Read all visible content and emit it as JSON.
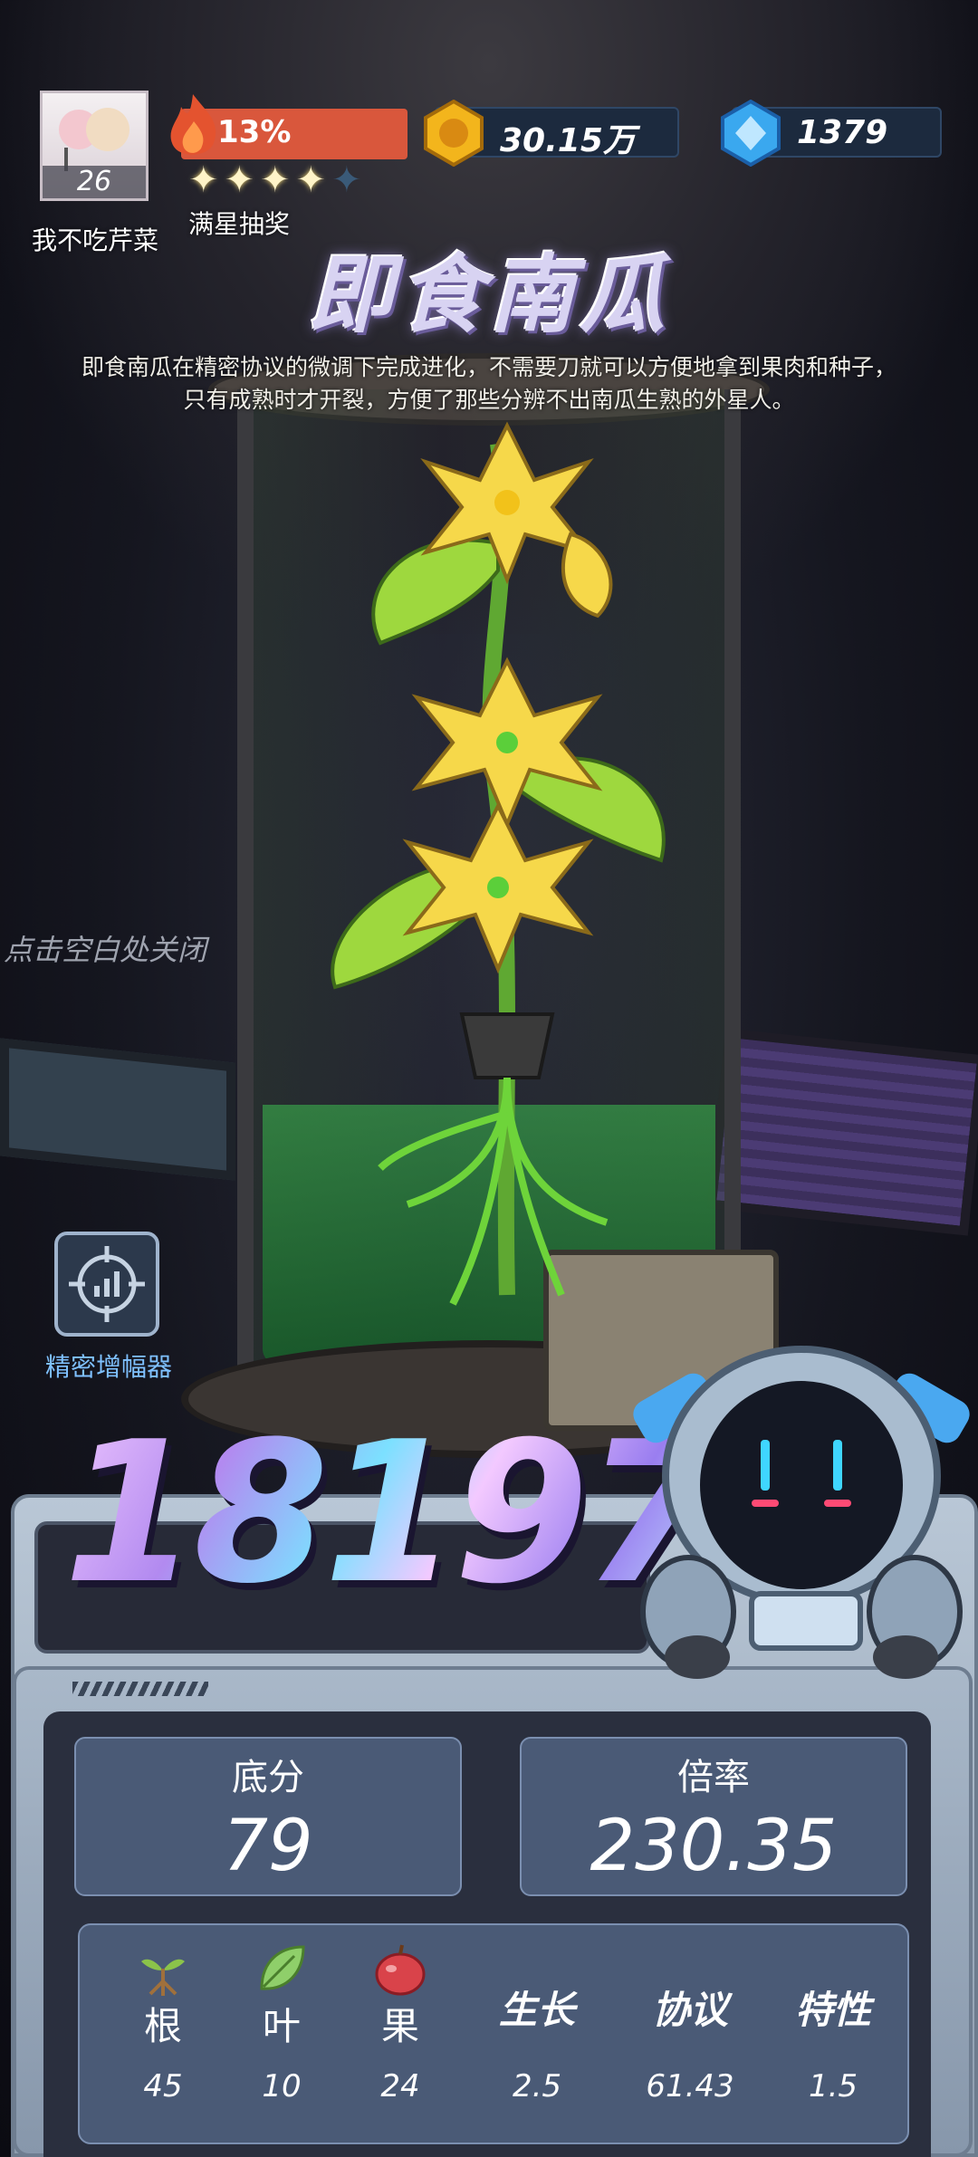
{
  "player": {
    "level": "26",
    "name": "我不吃芹菜"
  },
  "heat": {
    "percent_text": "13%",
    "stars_filled": 4,
    "stars_total": 5,
    "stars_label": "满星抽奖"
  },
  "currency": {
    "coins": "30.15万",
    "gems": "1379"
  },
  "item": {
    "title": "即食南瓜",
    "description": "即食南瓜在精密协议的微调下完成进化，不需要刀就可以方便地拿到果肉和种子，只有成熟时才开裂，方便了那些分辨不出南瓜生熟的外星人。"
  },
  "hints": {
    "close": "点击空白处关闭"
  },
  "amplifier": {
    "label": "精密增幅器",
    "icon": "target-chart-icon"
  },
  "score": {
    "total": "18197"
  },
  "stats": {
    "base_label": "底分",
    "base_value": "79",
    "multiplier_label": "倍率",
    "multiplier_value": "230.35"
  },
  "attributes": [
    {
      "label": "根",
      "value": "45",
      "icon": "sprout-icon"
    },
    {
      "label": "叶",
      "value": "10",
      "icon": "leaf-icon"
    },
    {
      "label": "果",
      "value": "24",
      "icon": "apple-icon"
    },
    {
      "label": "生长",
      "value": "2.5"
    },
    {
      "label": "协议",
      "value": "61.43"
    },
    {
      "label": "特性",
      "value": "1.5"
    }
  ],
  "colors": {
    "heat_bar": "#d9573c",
    "accent_blue": "#7fc1ff",
    "panel_box": "#4a5a76"
  }
}
